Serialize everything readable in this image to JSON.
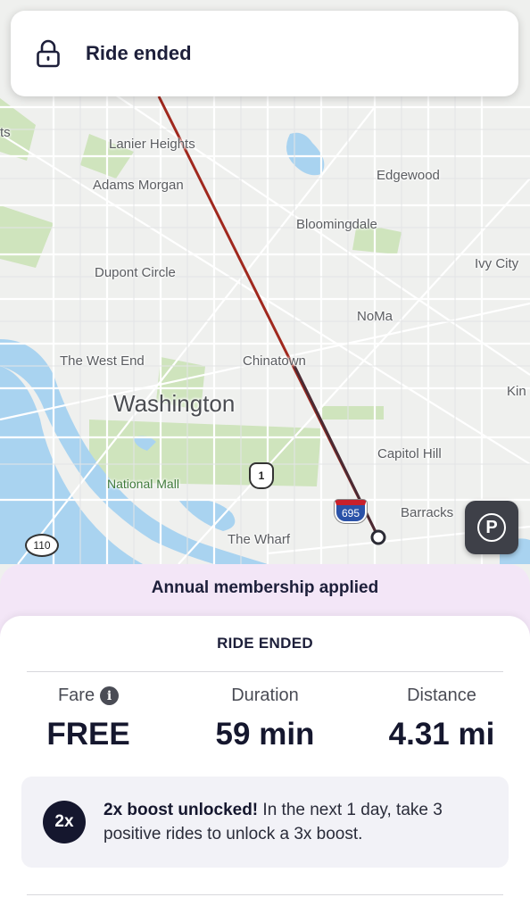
{
  "banner": {
    "title": "Ride ended",
    "icon": "lock-icon"
  },
  "map": {
    "labels": {
      "lanier_heights": "Lanier Heights",
      "adams_morgan": "Adams Morgan",
      "edgewood": "Edgewood",
      "bloomingdale": "Bloomingdale",
      "ivy_city": "Ivy City",
      "dupont_circle": "Dupont Circle",
      "noma": "NoMa",
      "the_west_end": "The West End",
      "chinatown": "Chinatown",
      "washington": "Washington",
      "kin": "Kin",
      "capitol_hill": "Capitol Hill",
      "national_mall": "National Mall",
      "barracks": "Barracks",
      "the_wharf": "The Wharf",
      "edge_left": "ts"
    },
    "shields": {
      "us_route": "1",
      "interstate": "695",
      "state_route": "110"
    },
    "route_color": "#a0281e",
    "parking_label": "P"
  },
  "membership": {
    "text": "Annual membership applied"
  },
  "sheet": {
    "heading": "RIDE ENDED",
    "stats": {
      "fare_label": "Fare",
      "fare_value": "FREE",
      "duration_label": "Duration",
      "duration_value": "59 min",
      "distance_label": "Distance",
      "distance_value": "4.31 mi"
    },
    "boost": {
      "badge": "2x",
      "title": "2x boost unlocked!",
      "body": " In the next 1 day, take 3 positive rides to unlock a 3x boost."
    }
  }
}
